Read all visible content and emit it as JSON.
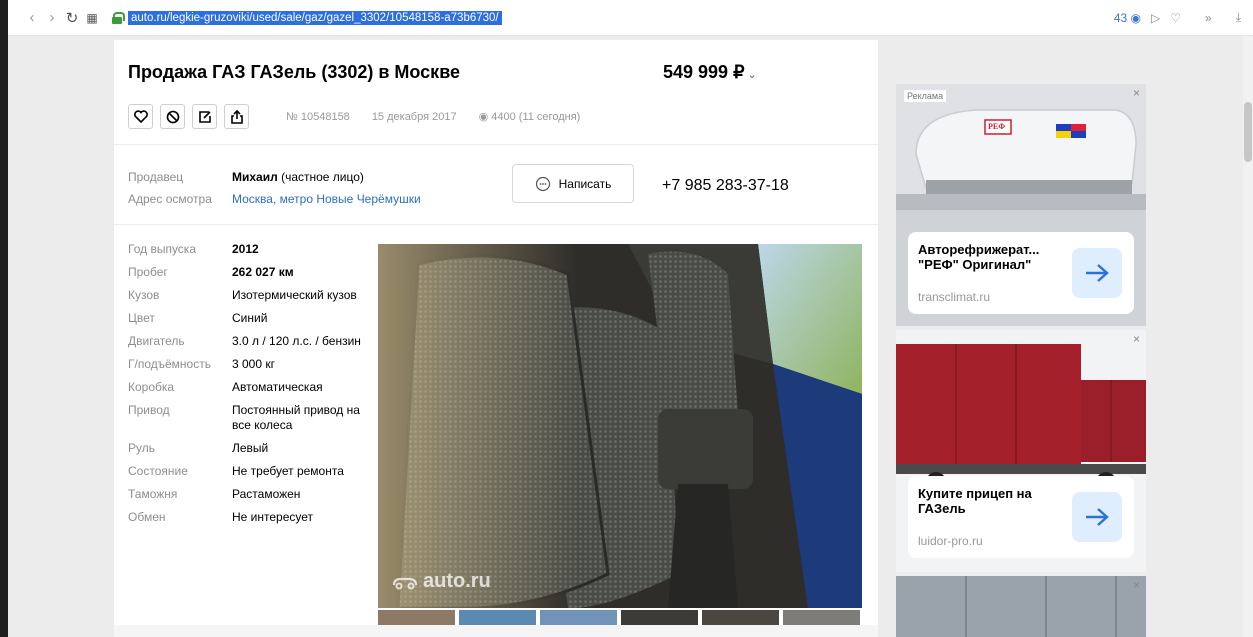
{
  "browser": {
    "url": "auto.ru/legkie-gruzoviki/used/sale/gaz/gazel_3302/10548158-a73b6730/",
    "tab_count": "43"
  },
  "listing": {
    "title": "Продажа ГАЗ ГАЗель (3302) в Москве",
    "price": "549 999 ₽",
    "number": "№ 10548158",
    "date": "15 декабря 2017",
    "views": "4400 (11 сегодня)"
  },
  "seller": {
    "seller_label": "Продавец",
    "seller_name": "Михаил",
    "seller_type": "(частное лицо)",
    "address_label": "Адрес осмотра",
    "address_value": "Москва, метро Новые Черёмушки",
    "write_label": "Написать",
    "phone": "+7 985 283-37-18"
  },
  "specs": [
    {
      "k": "Год выпуска",
      "v": "2012"
    },
    {
      "k": "Пробег",
      "v": "262 027 км"
    },
    {
      "k": "Кузов",
      "v": "Изотермический кузов"
    },
    {
      "k": "Цвет",
      "v": "Синий"
    },
    {
      "k": "Двигатель",
      "v": "3.0 л / 120 л.с. / бензин"
    },
    {
      "k": "Г/подъёмность",
      "v": "3 000 кг"
    },
    {
      "k": "Коробка",
      "v": "Автоматическая"
    },
    {
      "k": "Привод",
      "v": "Постоянный привод на все колеса"
    },
    {
      "k": "Руль",
      "v": "Левый"
    },
    {
      "k": "Состояние",
      "v": "Не требует ремонта"
    },
    {
      "k": "Таможня",
      "v": "Растаможен"
    },
    {
      "k": "Обмен",
      "v": "Не интересует"
    }
  ],
  "photo": {
    "watermark": "auto.ru"
  },
  "ads": {
    "tag": "Реклама",
    "ad1": {
      "headline": "Авторефрижерат... \"РЕФ\" Оригинал\"",
      "domain": "transclimat.ru",
      "logo_text": "РЕФ"
    },
    "ad2": {
      "headline": "Купите прицеп на ГАЗель",
      "domain": "luidor-pro.ru"
    }
  }
}
